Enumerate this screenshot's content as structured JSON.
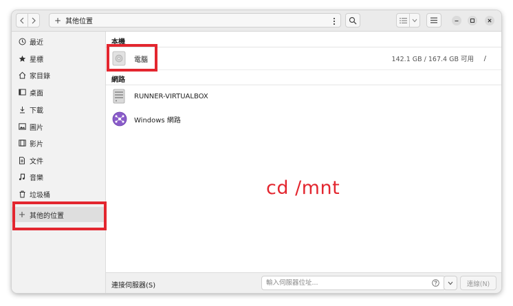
{
  "header": {
    "location_label": "其他位置"
  },
  "sidebar": {
    "items": [
      {
        "label": "最近",
        "icon": "clock-icon"
      },
      {
        "label": "星標",
        "icon": "star-icon"
      },
      {
        "label": "家目錄",
        "icon": "home-icon"
      },
      {
        "label": "桌面",
        "icon": "desktop-icon"
      },
      {
        "label": "下載",
        "icon": "download-icon"
      },
      {
        "label": "圖片",
        "icon": "picture-icon"
      },
      {
        "label": "影片",
        "icon": "video-icon"
      },
      {
        "label": "文件",
        "icon": "document-icon"
      },
      {
        "label": "音樂",
        "icon": "music-icon"
      },
      {
        "label": "垃圾桶",
        "icon": "trash-icon"
      },
      {
        "label": "其他的位置",
        "icon": "plus-icon",
        "active": true
      }
    ]
  },
  "main": {
    "local_section": "本機",
    "computer": {
      "name": "電腦",
      "usage": "142.1 GB / 167.4 GB 可用",
      "mount": "/"
    },
    "network_section": "網路",
    "network_items": [
      {
        "name": "RUNNER-VIRTUALBOX",
        "icon": "server-icon"
      },
      {
        "name": "Windows 網路",
        "icon": "windows-network-icon"
      }
    ],
    "annotation": "cd /mnt"
  },
  "bottom": {
    "connect_label": "連接伺服器(S)",
    "server_placeholder": "輸入伺服器位址...",
    "connect_button": "連線(N)"
  },
  "colors": {
    "highlight": "#e3262f",
    "sidebar_bg": "#f2f2f2",
    "header_bg": "#ebebeb"
  }
}
